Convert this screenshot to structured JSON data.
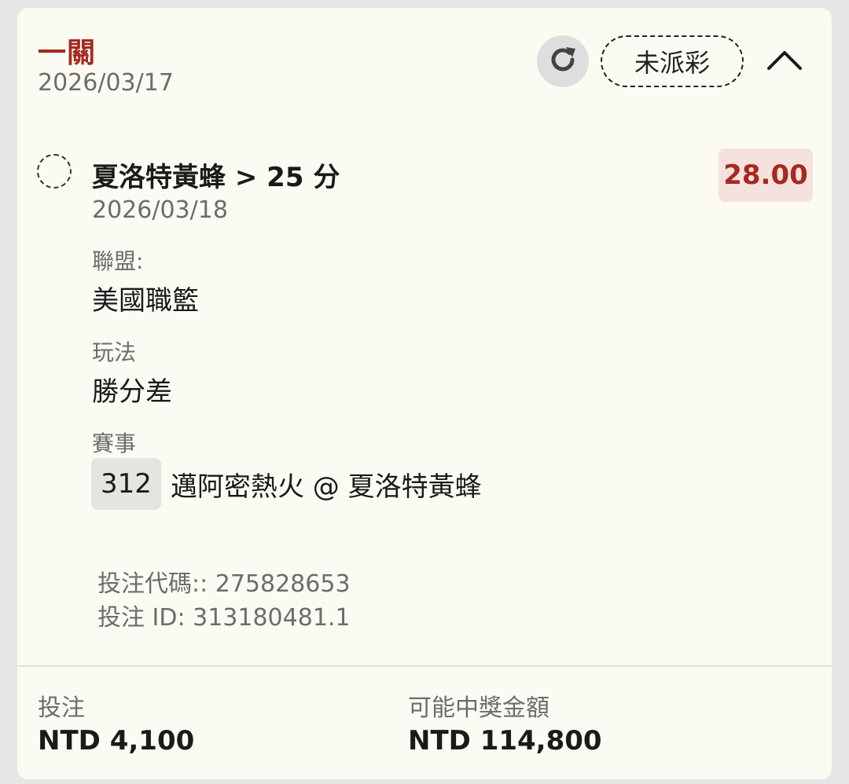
{
  "header": {
    "title": "一關",
    "date": "2026/03/17",
    "status": "未派彩"
  },
  "icons": {
    "refresh": "refresh-icon",
    "collapse": "chevron-up-icon",
    "radio": "radio-unselected-icon"
  },
  "bet": {
    "selection": "夏洛特黃蜂 > 25 分",
    "odds": "28.00",
    "match_date": "2026/03/18",
    "league_label": "聯盟:",
    "league_value": "美國職籃",
    "play_label": "玩法",
    "play_value": "勝分差",
    "event_label": "賽事",
    "event_number": "312",
    "event_name": "邁阿密熱火 @ 夏洛特黃蜂",
    "bet_code": "投注代碼:: 275828653",
    "bet_id": "投注 ID: 313180481.1"
  },
  "footer": {
    "stake_label": "投注",
    "stake_value": "NTD 4,100",
    "payout_label": "可能中獎金額",
    "payout_value": "NTD 114,800"
  },
  "colors": {
    "accent": "#a52a1f",
    "card_bg": "#fcfbf3",
    "odds_bg": "#f6e2dc"
  }
}
